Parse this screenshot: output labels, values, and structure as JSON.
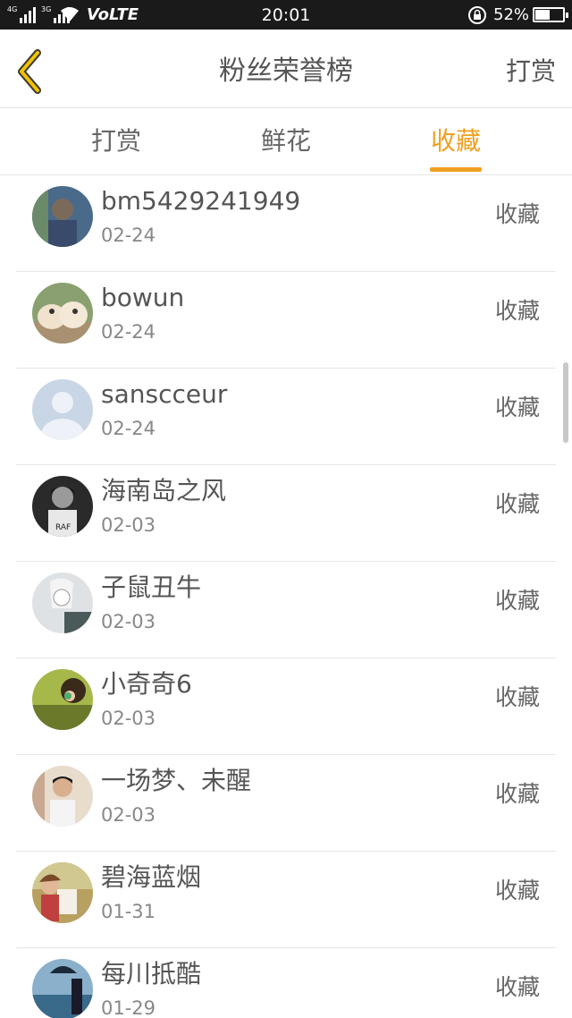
{
  "status_bar": {
    "network_1": "4G",
    "network_2": "3G",
    "volte": "VoLTE",
    "time": "20:01",
    "battery_percent": "52%",
    "battery_level": 0.52
  },
  "nav": {
    "back_icon": "chevron-left-icon",
    "title": "粉丝荣誉榜",
    "action": "打赏"
  },
  "tabs": [
    {
      "label": "打赏",
      "active": false
    },
    {
      "label": "鲜花",
      "active": false
    },
    {
      "label": "收藏",
      "active": true
    }
  ],
  "accent_color": "#f0a020",
  "fans": [
    {
      "name": "bm5429241949",
      "date": "02-24",
      "action": "收藏"
    },
    {
      "name": "bowun",
      "date": "02-24",
      "action": "收藏"
    },
    {
      "name": "sanscceur",
      "date": "02-24",
      "action": "收藏"
    },
    {
      "name": "海南岛之风",
      "date": "02-03",
      "action": "收藏"
    },
    {
      "name": "子鼠丑牛",
      "date": "02-03",
      "action": "收藏"
    },
    {
      "name": "小奇奇6",
      "date": "02-03",
      "action": "收藏"
    },
    {
      "name": "一场梦、未醒",
      "date": "02-03",
      "action": "收藏"
    },
    {
      "name": "碧海蓝烟",
      "date": "01-31",
      "action": "收藏"
    },
    {
      "name": "每川抵酷",
      "date": "01-29",
      "action": "收藏"
    }
  ]
}
